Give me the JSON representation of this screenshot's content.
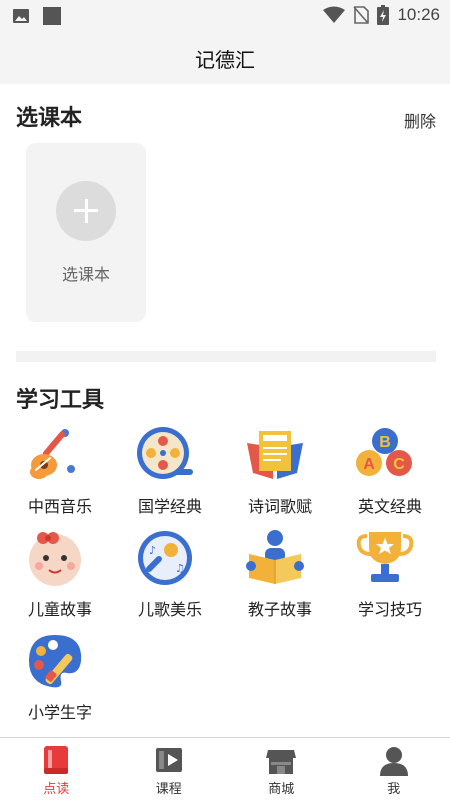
{
  "status_bar": {
    "time": "10:26"
  },
  "header": {
    "title": "记德汇"
  },
  "course_section": {
    "title": "选课本",
    "delete_label": "删除",
    "add_card_label": "选课本"
  },
  "tools_section": {
    "title": "学习工具",
    "items": [
      {
        "label": "中西音乐",
        "icon": "guitar-icon"
      },
      {
        "label": "国学经典",
        "icon": "film-reel-icon"
      },
      {
        "label": "诗词歌赋",
        "icon": "book-icon"
      },
      {
        "label": "英文经典",
        "icon": "abc-blocks-icon"
      },
      {
        "label": "儿童故事",
        "icon": "baby-face-icon"
      },
      {
        "label": "儿歌美乐",
        "icon": "microphone-icon"
      },
      {
        "label": "教子故事",
        "icon": "reading-person-icon"
      },
      {
        "label": "学习技巧",
        "icon": "trophy-icon"
      },
      {
        "label": "小学生字",
        "icon": "paint-palette-icon"
      }
    ]
  },
  "tab_bar": {
    "tabs": [
      {
        "label": "点读",
        "icon": "book-tab-icon",
        "active": true
      },
      {
        "label": "课程",
        "icon": "video-tab-icon",
        "active": false
      },
      {
        "label": "商城",
        "icon": "store-tab-icon",
        "active": false
      },
      {
        "label": "我",
        "icon": "person-tab-icon",
        "active": false
      }
    ]
  },
  "colors": {
    "accent": "#e83a3a",
    "background": "#ffffff",
    "header_bg": "#f4f4f4"
  }
}
